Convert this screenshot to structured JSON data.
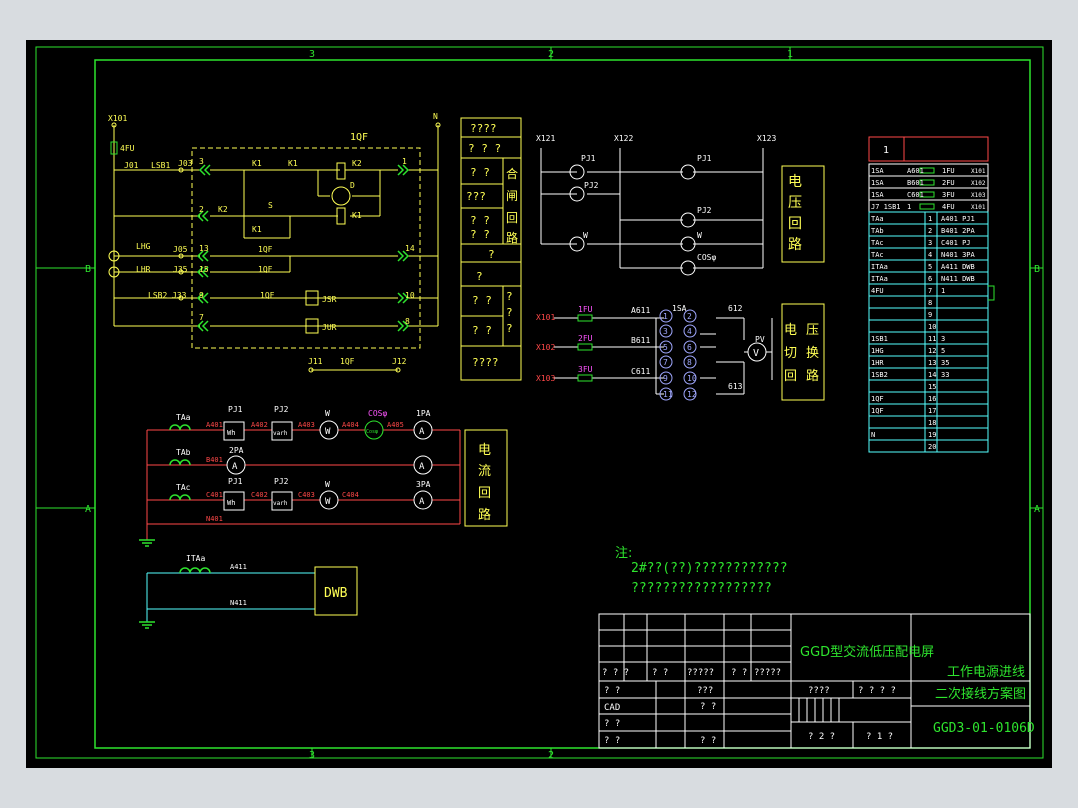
{
  "border": {
    "top": [
      "3",
      "2",
      "1"
    ],
    "bottom": [
      "3",
      "2"
    ],
    "sides": [
      "B",
      "A"
    ]
  },
  "control_circuit": {
    "title": "1QF",
    "node_left": "X101",
    "node_right": "N",
    "fuse": "4FU",
    "labels": {
      "j01": "J01",
      "lsb1": "LSB1",
      "j03": "J03",
      "t3": "3",
      "t1": "1",
      "t2": "2",
      "t4": "4",
      "t7": "7",
      "t8": "8",
      "t9": "9",
      "t10": "10",
      "t13": "13",
      "t14": "14",
      "t15": "15",
      "k1a": "K1",
      "k1b": "K1",
      "k1c": "K1",
      "k2a": "K2",
      "k2b": "K2",
      "s": "S",
      "d": "D",
      "lhg": "LHG",
      "lhr": "LHR",
      "j05": "J05",
      "j35": "J35",
      "j33": "J33",
      "lsb2": "LSB2",
      "qf1": "1QF",
      "qf2": "1QF",
      "qf3": "1QF",
      "qf4": "1QF",
      "jsr": "JSR",
      "jur": "JUR",
      "j11": "J11",
      "j12": "J12"
    }
  },
  "function_table": {
    "rows": [
      "????",
      "? ? ?",
      "? ?",
      "???",
      "? ?\n? ?",
      "?",
      "?",
      "? ?",
      "? ?",
      "????"
    ],
    "side": [
      "合",
      "闸",
      "回",
      "路"
    ]
  },
  "voltage_circuit": {
    "nodes": [
      "X121",
      "X122",
      "X123"
    ],
    "lamps": [
      "PJ1",
      "PJ2",
      "PJ1",
      "PJ2",
      "W",
      "W",
      "COSφ"
    ],
    "title": [
      "电",
      "压",
      "回",
      "路"
    ]
  },
  "switch_circuit": {
    "inputs": [
      "X101",
      "X102",
      "X103"
    ],
    "fuses": [
      "1FU",
      "2FU",
      "3FU"
    ],
    "phases": [
      "A611",
      "B611",
      "C611"
    ],
    "switch": "1SA",
    "left_nums": [
      "1",
      "3",
      "5",
      "7",
      "9",
      "11"
    ],
    "right_nums": [
      "2",
      "4",
      "6",
      "8",
      "10",
      "12"
    ],
    "points": [
      "612",
      "613"
    ],
    "meter": "PV",
    "meter_symbol": "V",
    "title": [
      "电",
      "压",
      "切",
      "换",
      "回",
      "路"
    ]
  },
  "current_circuit": {
    "rows": [
      {
        "ct": "TAa",
        "items": [
          "A401",
          "PJ1",
          "A402",
          "PJ2",
          "A403",
          "W",
          "A404",
          "COSφ",
          "A405",
          "1PA"
        ]
      },
      {
        "ct": "TAb",
        "items": [
          "B401",
          "2PA"
        ]
      },
      {
        "ct": "TAc",
        "items": [
          "C401",
          "PJ1",
          "C402",
          "PJ2",
          "C403",
          "W",
          "C404",
          "3PA"
        ]
      }
    ],
    "neutral": "N401",
    "symbols": {
      "wh": "Wh",
      "varh": "varh",
      "w": "W",
      "a": "A",
      "cos": "Cosφ"
    },
    "title": [
      "电",
      "流",
      "回",
      "路"
    ]
  },
  "dwb_circuit": {
    "ct": "ITAa",
    "a": "A411",
    "n": "N411",
    "box": "DWB"
  },
  "terminal_block": {
    "header": "1",
    "rows": [
      {
        "l": "1SA",
        "m": "A601",
        "r": "1FU",
        "x": "X101"
      },
      {
        "l": "1SA",
        "m": "B601",
        "r": "2FU",
        "x": "X102"
      },
      {
        "l": "1SA",
        "m": "C601",
        "r": "3FU",
        "x": "X103"
      },
      {
        "l": "J7\n1SB1",
        "m": "1",
        "r": "4FU",
        "x": "X101"
      },
      {
        "l": "TAa",
        "m": "1",
        "r": "A401  PJ1"
      },
      {
        "l": "TAb",
        "m": "2",
        "r": "B401  2PA"
      },
      {
        "l": "TAc",
        "m": "3",
        "r": "C401  PJ"
      },
      {
        "l": "TAc",
        "m": "4",
        "r": "N401  3PA"
      },
      {
        "l": "ITAa",
        "m": "5",
        "r": "A411  DWB"
      },
      {
        "l": "ITAa",
        "m": "6",
        "r": "N411  DWB"
      },
      {
        "l": "4FU",
        "m": "7",
        "r": "1"
      },
      {
        "l": "",
        "m": "8",
        "r": ""
      },
      {
        "l": "",
        "m": "9",
        "r": ""
      },
      {
        "l": "",
        "m": "10",
        "r": ""
      },
      {
        "l": "1SB1",
        "m": "11",
        "r": "3"
      },
      {
        "l": "1HG",
        "m": "12",
        "r": "5"
      },
      {
        "l": "1HR",
        "m": "13",
        "r": "35"
      },
      {
        "l": "1SB2",
        "m": "14",
        "r": "33"
      },
      {
        "l": "",
        "m": "15",
        "r": ""
      },
      {
        "l": "1QF",
        "m": "16",
        "r": ""
      },
      {
        "l": "1QF",
        "m": "17",
        "r": ""
      },
      {
        "l": "",
        "m": "18",
        "r": ""
      },
      {
        "l": "N",
        "m": "19",
        "r": ""
      },
      {
        "l": "",
        "m": "20",
        "r": ""
      }
    ]
  },
  "notes": {
    "title": "注:",
    "line1": "2#??(??)????????????",
    "line2": "??????????????????"
  },
  "title_block": {
    "project": "GGD型交流低压配电屏",
    "name1": "工作电源进线",
    "name2": "二次接线方案图",
    "drawing_no": "GGD3-01-0106D",
    "cad": "CAD",
    "r1": [
      "? ? ?",
      "? ?",
      "?????",
      "? ?",
      "?????"
    ],
    "r2": [
      "? ?",
      "???"
    ],
    "r4": [
      "? ?",
      "? ?"
    ],
    "r5": [
      "? ?",
      "? ?"
    ],
    "stage": "????",
    "scale": "? ? ? ?",
    "sheet": "? 2 ?",
    "total": "? 1 ?"
  }
}
